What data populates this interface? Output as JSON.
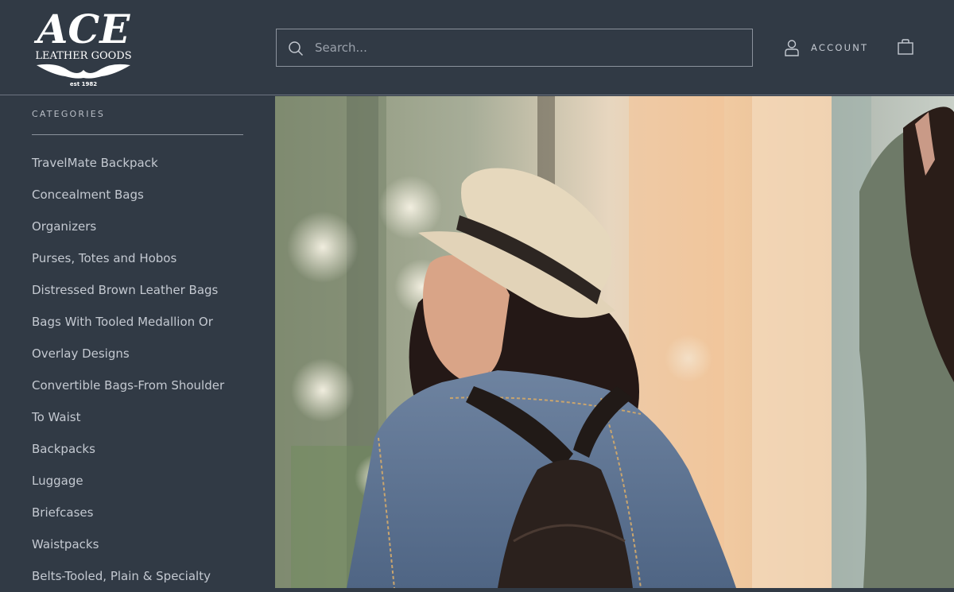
{
  "brand": {
    "logo_line1": "ACE",
    "logo_line2": "LEATHER GOODS",
    "logo_line3": "est 1982"
  },
  "search": {
    "placeholder": "Search...",
    "value": "",
    "icon": "search-icon"
  },
  "account": {
    "label": "ACCOUNT",
    "icon": "user-icon"
  },
  "cart": {
    "icon": "shopping-bag-icon"
  },
  "sidebar": {
    "heading": "CATEGORIES",
    "items": [
      "TravelMate Backpack",
      "Concealment Bags",
      "Organizers",
      "Purses, Totes and Hobos",
      "Distressed Brown Leather Bags",
      "Bags With Tooled Medallion Or",
      "Overlay Designs",
      "Convertible Bags-From Shoulder",
      "To Waist",
      "Backpacks",
      "Luggage",
      "Briefcases",
      "Waistpacks",
      "Belts-Tooled, Plain & Specialty"
    ]
  },
  "colors": {
    "background": "#313a45",
    "text": "#c4c9d1",
    "border": "#8b929c"
  }
}
